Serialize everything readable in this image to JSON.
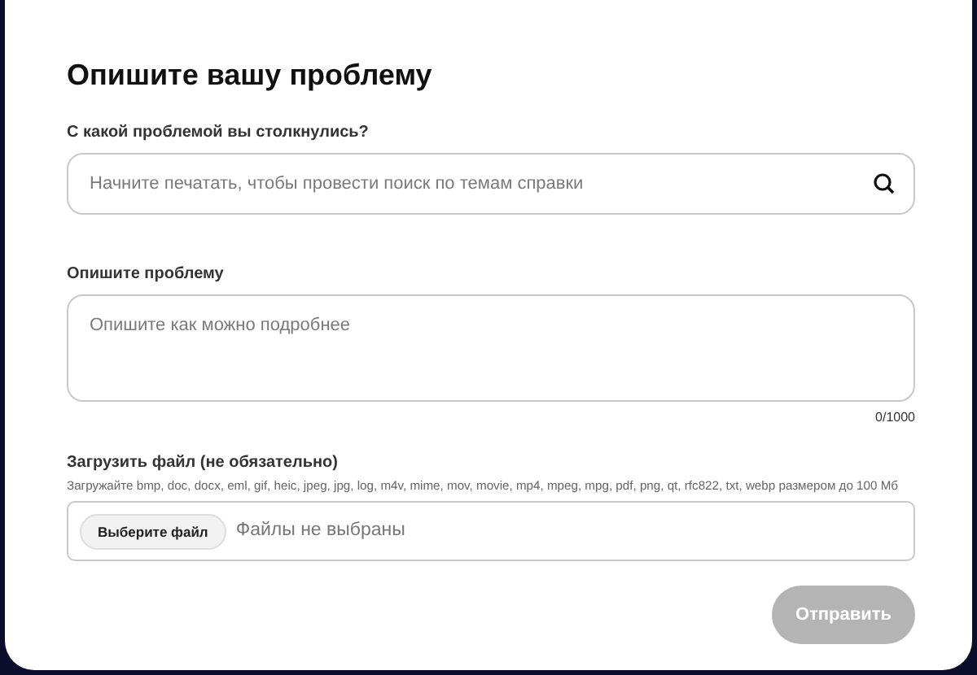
{
  "title": "Опишите вашу проблему",
  "search": {
    "label": "С какой проблемой вы столкнулись?",
    "placeholder": "Начните печатать, чтобы провести поиск по темам справки"
  },
  "description": {
    "label": "Опишите проблему",
    "placeholder": "Опишите как можно подробнее",
    "counter": "0/1000"
  },
  "upload": {
    "label": "Загрузить файл (не обязательно)",
    "hint": "Загружайте bmp, doc, docx, eml, gif, heic, jpeg, jpg, log, m4v, mime, mov, movie, mp4, mpeg, mpg, pdf, png, qt, rfc822, txt, webp размером до 100 Мб",
    "button": "Выберите файл",
    "status": "Файлы не выбраны"
  },
  "submit": {
    "label": "Отправить",
    "disabled": true
  }
}
